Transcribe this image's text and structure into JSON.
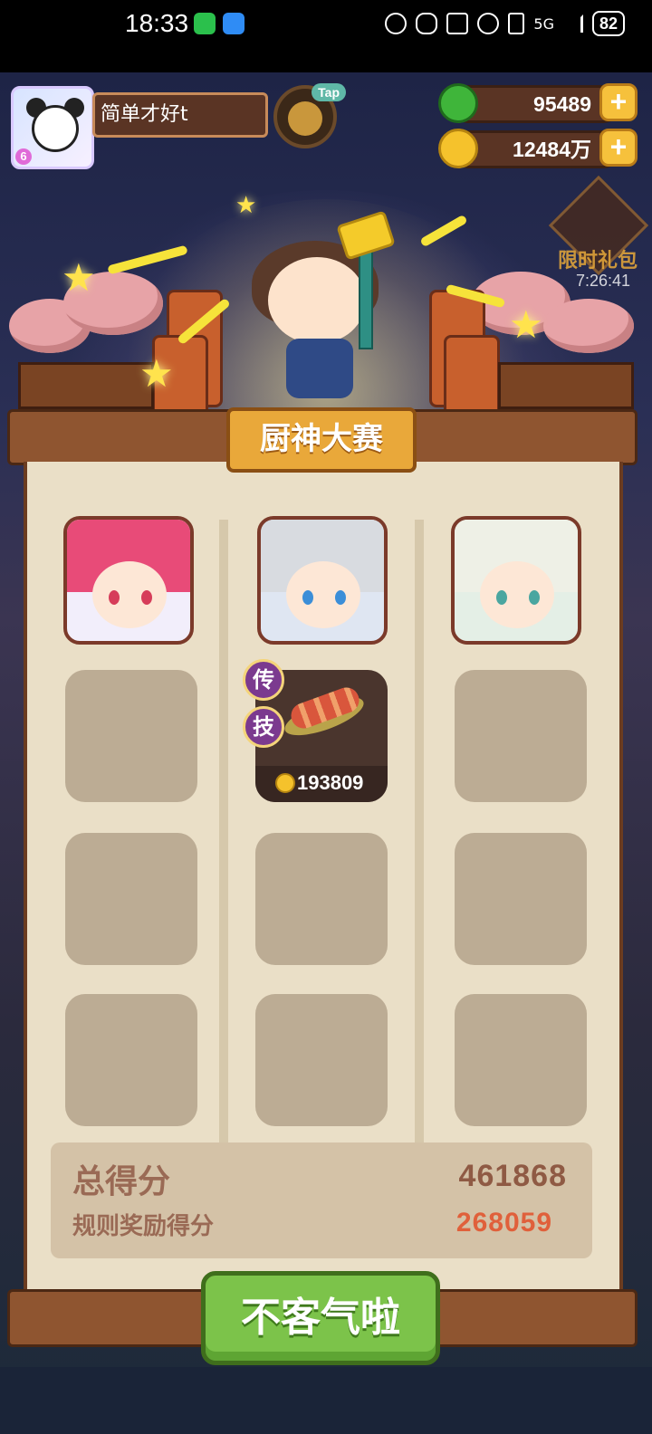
{
  "status_bar": {
    "time": "18:33",
    "signal": "5G",
    "battery": "82"
  },
  "player": {
    "name": "简单才好t",
    "level_badge": "6",
    "tap_label": "Tap"
  },
  "currencies": [
    {
      "icon": "green-apple-icon",
      "value": "95489"
    },
    {
      "icon": "gold-coin-icon",
      "value": "12484万"
    }
  ],
  "gift": {
    "label": "限时礼包",
    "timer": "7:26:41"
  },
  "contest": {
    "title": "厨神大赛",
    "dish": {
      "tags": [
        "传",
        "技"
      ],
      "score": "193809"
    }
  },
  "summary": {
    "total_label": "总得分",
    "total_value": "461868",
    "rule_label": "规则奖励得分",
    "rule_value": "268059"
  },
  "action": {
    "confirm_label": "不客气啦"
  },
  "colors": {
    "board": "#eadfc7",
    "wood": "#8f5530",
    "confirm_green": "#7cc34a",
    "rule_value_red": "#e0603b"
  }
}
